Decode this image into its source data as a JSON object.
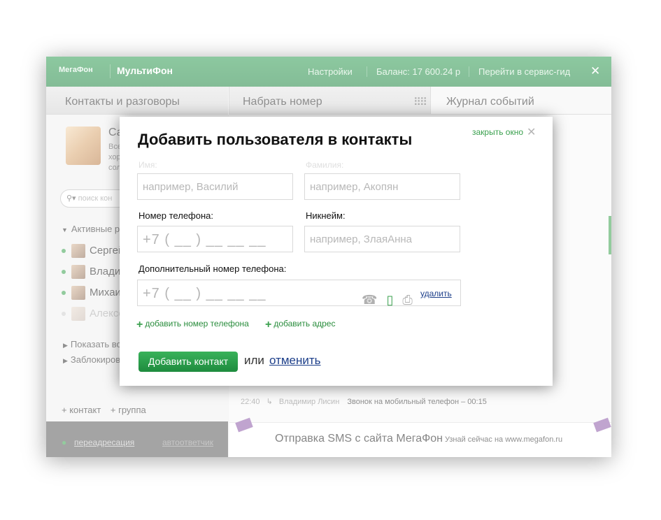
{
  "topbar": {
    "logo": "МегаФон",
    "app_name": "МультиФон",
    "settings": "Настройки",
    "balance": "Баланс: 17 600.24 р",
    "service_guide": "Перейти в сервис-гид",
    "close": "✕"
  },
  "columns": {
    "contacts_title": "Контакты и разговоры",
    "dial_title": "Набрать номер",
    "journal_title": "Журнал событий"
  },
  "profile": {
    "name": "Са",
    "line1": "Все",
    "line2": "хор",
    "line3": "сол"
  },
  "contacts": {
    "search_placeholder": "поиск кон",
    "active_group": "Активные р",
    "items": [
      "Сергей",
      "Влади",
      "Михаи",
      "Алексе"
    ],
    "show_all": "Показать во",
    "blocked": "Заблокиров",
    "add_contact": "+ контакт",
    "add_group": "+ группа"
  },
  "footer": {
    "forwarding": "переадресация",
    "answering": "автоответчик"
  },
  "call_row": {
    "time": "22:40",
    "name": "Владимир Лисин",
    "desc": "Звонок на мобильный телефон –",
    "duration": "00:15"
  },
  "banner": {
    "title": "Отправка SMS с сайта МегаФон",
    "sub": "Узнай сейчас на www.megafon.ru"
  },
  "modal": {
    "title": "Добавить пользователя в контакты",
    "close_label": "закрыть окно",
    "close_icon": "✕",
    "name_label": "Имя:",
    "surname_label": "Фамилия:",
    "name_placeholder": "например, Василий",
    "surname_placeholder": "например, Акопян",
    "phone_label": "Номер телефона:",
    "nick_label": "Никнейм:",
    "phone_mask": "+7 ( __ ) __ __ __",
    "nick_placeholder": "например, ЗлаяАнна",
    "extra_phone_label": "Дополнительный номер телефона:",
    "extra_phone_mask": "+7 ( __ ) __ __ __",
    "delete_label": "удалить",
    "add_phone": "добавить номер телефона",
    "add_address": "добавить адрес",
    "submit": "Добавить контакт",
    "or": "или",
    "cancel": "отменить"
  },
  "colors": {
    "accent_green": "#3aa04e",
    "link_blue": "#1d3f8a",
    "topbar_green": "#2f9c52"
  }
}
